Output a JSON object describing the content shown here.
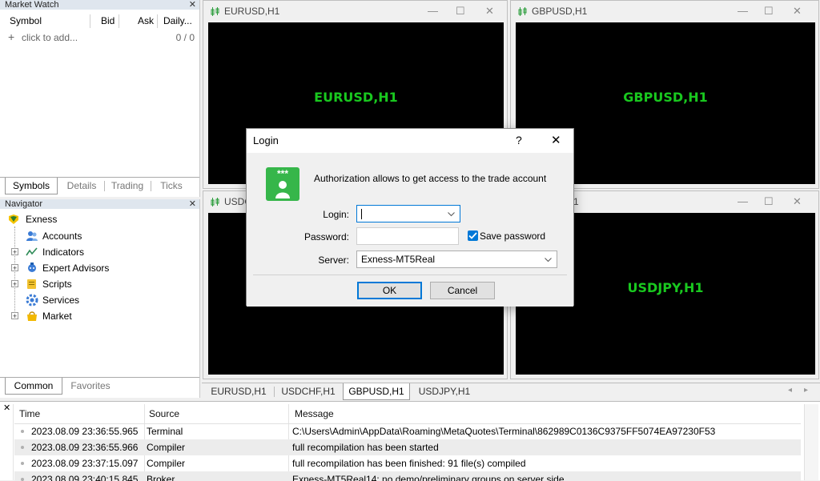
{
  "market_watch": {
    "title": "Market Watch",
    "columns": [
      "Symbol",
      "Bid",
      "Ask",
      "Daily..."
    ],
    "add_row": {
      "label": "click to add...",
      "count": "0 / 0"
    },
    "tabs": [
      "Symbols",
      "Details",
      "Trading",
      "Ticks"
    ],
    "active_tab": "Symbols"
  },
  "navigator": {
    "title": "Navigator",
    "root": "Exness",
    "items": [
      {
        "label": "Accounts",
        "icon": "accounts-icon",
        "expandable": false
      },
      {
        "label": "Indicators",
        "icon": "indicators-icon",
        "expandable": true
      },
      {
        "label": "Expert Advisors",
        "icon": "expert-advisors-icon",
        "expandable": true
      },
      {
        "label": "Scripts",
        "icon": "scripts-icon",
        "expandable": true
      },
      {
        "label": "Services",
        "icon": "services-icon",
        "expandable": false
      },
      {
        "label": "Market",
        "icon": "market-icon",
        "expandable": true
      }
    ],
    "tabs": [
      "Common",
      "Favorites"
    ],
    "active_tab": "Common"
  },
  "charts": [
    {
      "title": "EURUSD,H1",
      "label": "EURUSD,H1"
    },
    {
      "title": "GBPUSD,H1",
      "label": "GBPUSD,H1"
    },
    {
      "title": "USDC",
      "label": ""
    },
    {
      "title": "1",
      "label": "USDJPY,H1"
    }
  ],
  "chart_tabs": [
    "EURUSD,H1",
    "USDCHF,H1",
    "GBPUSD,H1",
    "USDJPY,H1"
  ],
  "active_chart_tab": "GBPUSD,H1",
  "toolbox": {
    "columns": [
      "Time",
      "Source",
      "Message"
    ],
    "rows": [
      {
        "time": "2023.08.09 23:36:55.965",
        "source": "Terminal",
        "message": "C:\\Users\\Admin\\AppData\\Roaming\\MetaQuotes\\Terminal\\862989C0136C9375FF5074EA97230F53"
      },
      {
        "time": "2023.08.09 23:36:55.966",
        "source": "Compiler",
        "message": "full recompilation has been started"
      },
      {
        "time": "2023.08.09 23:37:15.097",
        "source": "Compiler",
        "message": "full recompilation has been finished:  91 file(s) compiled"
      },
      {
        "time": "2023.08.09 23:40:15.845",
        "source": "Broker",
        "message": "Exness-MT5Real14: no demo/preliminary groups on server side"
      }
    ]
  },
  "login_dialog": {
    "title": "Login",
    "help": "?",
    "close": "✕",
    "description": "Authorization allows to get access to the trade account",
    "login_label": "Login:",
    "login_value": "",
    "password_label": "Password:",
    "password_value": "",
    "save_password_label": "Save password",
    "save_password_checked": true,
    "server_label": "Server:",
    "server_value": "Exness-MT5Real",
    "ok_label": "OK",
    "cancel_label": "Cancel",
    "icon_text": "***"
  },
  "colors": {
    "chart_label": "#19c81f",
    "accent": "#0078d7",
    "icon_green": "#36b64a"
  }
}
